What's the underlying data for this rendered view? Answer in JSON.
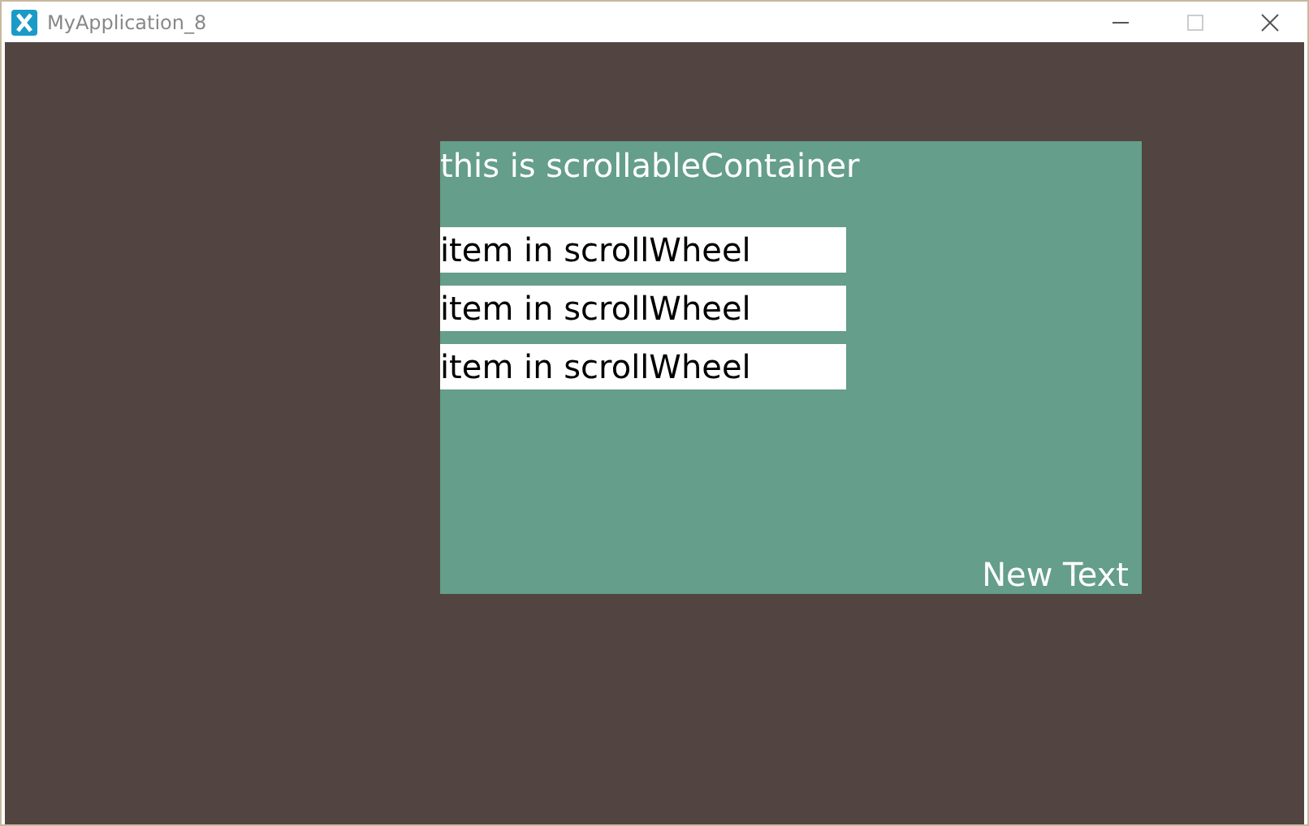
{
  "window": {
    "title": "MyApplication_8"
  },
  "container": {
    "title": "this is scrollableContainer",
    "items": [
      "item in scrollWheel",
      "item in scrollWheel",
      "item in scrollWheel"
    ],
    "footer_text": "New Text"
  }
}
